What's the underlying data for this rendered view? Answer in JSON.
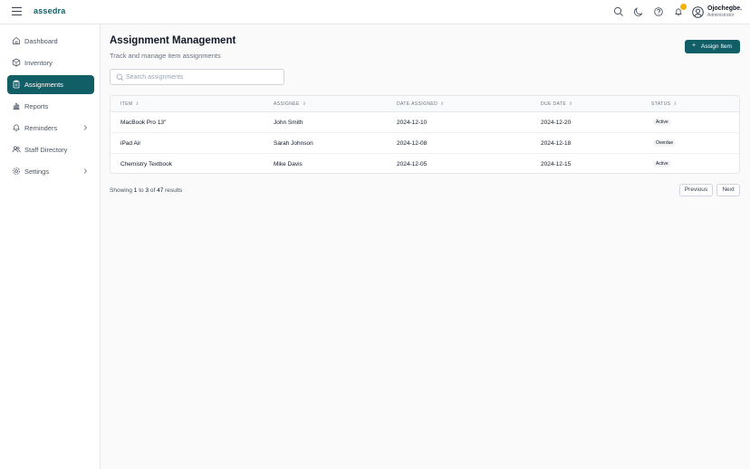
{
  "app": {
    "logo": "assedra"
  },
  "user": {
    "name": "Ojochegbe.",
    "role": "Administrator"
  },
  "sidebar": {
    "items": [
      {
        "label": "Dashboard",
        "icon": "home-icon",
        "active": false
      },
      {
        "label": "Inventory",
        "icon": "box-icon",
        "active": false
      },
      {
        "label": "Assignments",
        "icon": "clipboard-icon",
        "active": true
      },
      {
        "label": "Reports",
        "icon": "bar-chart-icon",
        "active": false
      },
      {
        "label": "Reminders",
        "icon": "bell-icon",
        "active": false,
        "expandable": true
      },
      {
        "label": "Staff Directory",
        "icon": "users-icon",
        "active": false
      },
      {
        "label": "Settings",
        "icon": "gear-icon",
        "active": false,
        "expandable": true
      }
    ]
  },
  "page": {
    "title": "Assignment Management",
    "subtitle": "Track and manage item assignments",
    "assign_button": "Assign Item"
  },
  "search": {
    "placeholder": "Search assignments",
    "value": ""
  },
  "table": {
    "headers": [
      "ITEM",
      "ASSIGNEE",
      "DATE ASSIGNED",
      "DUE DATE",
      "STATUS"
    ],
    "rows": [
      {
        "item": "MacBook Pro 13\"",
        "assignee": "John Smith",
        "date_assigned": "2024-12-10",
        "due_date": "2024-12-20",
        "status": "Active"
      },
      {
        "item": "iPad Air",
        "assignee": "Sarah Johnson",
        "date_assigned": "2024-12-08",
        "due_date": "2024-12-18",
        "status": "Overdue"
      },
      {
        "item": "Chemistry Textbook",
        "assignee": "Mike Davis",
        "date_assigned": "2024-12-05",
        "due_date": "2024-12-15",
        "status": "Active"
      }
    ]
  },
  "pagination": {
    "prefix": "Showing",
    "from": "1",
    "to_word": "to",
    "to": "3",
    "of_word": "of",
    "total": "47",
    "suffix": "results",
    "previous": "Previous",
    "next": "Next"
  },
  "colors": {
    "brand": "#115e67",
    "badge": "#f5b400"
  }
}
